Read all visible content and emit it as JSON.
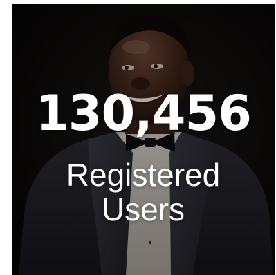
{
  "stat": {
    "value": "130,456",
    "label_line1": "Registered",
    "label_line2": "Users"
  },
  "colors": {
    "background": "#0b0a0a",
    "text": "#ffffff",
    "page": "#ffffff"
  }
}
